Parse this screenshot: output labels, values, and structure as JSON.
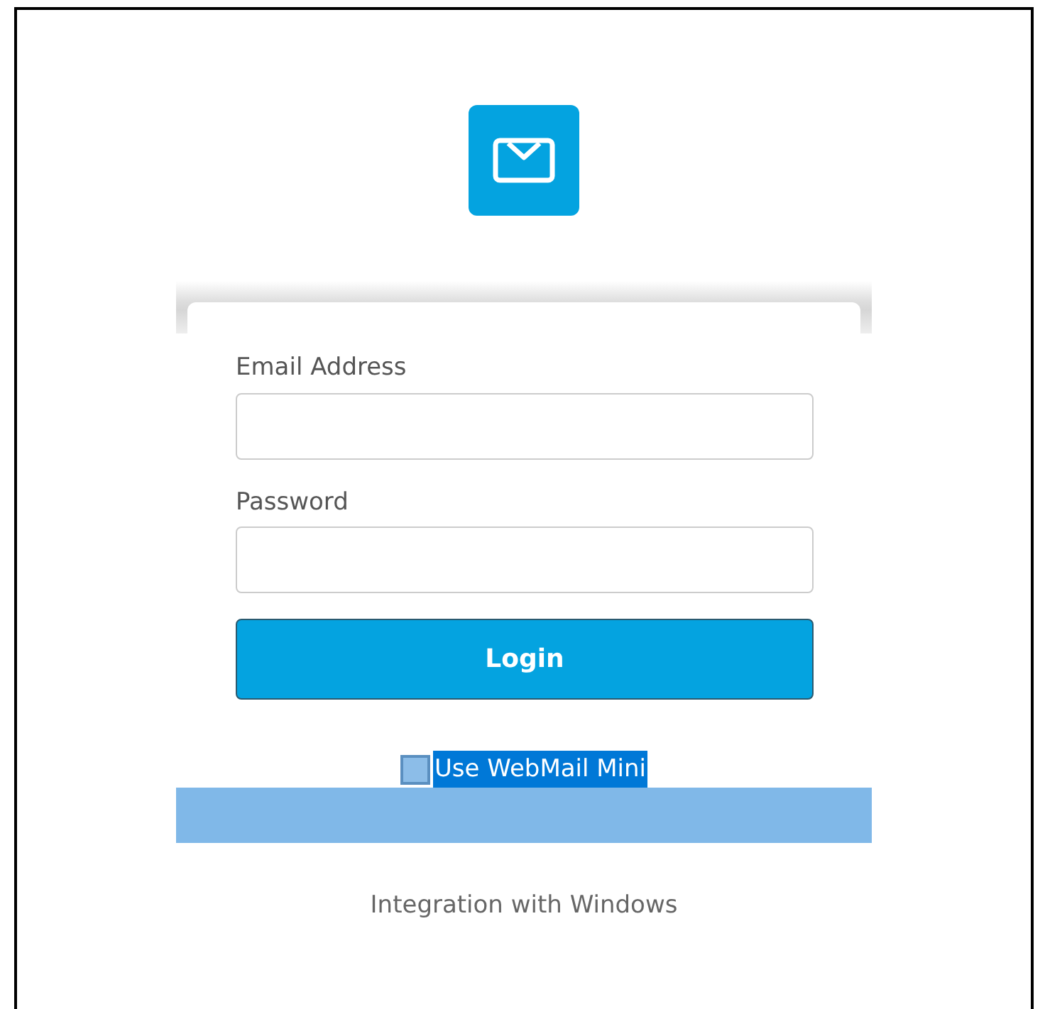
{
  "logo": {
    "kind": "mail"
  },
  "fields": [
    {
      "label": "Email Address"
    },
    {
      "label": "Password"
    }
  ],
  "login_button": {
    "label": "Login"
  },
  "option": {
    "label": "Use WebMail Mini",
    "checked": false,
    "selected": true
  },
  "footer_link": "Integration with Windows"
}
